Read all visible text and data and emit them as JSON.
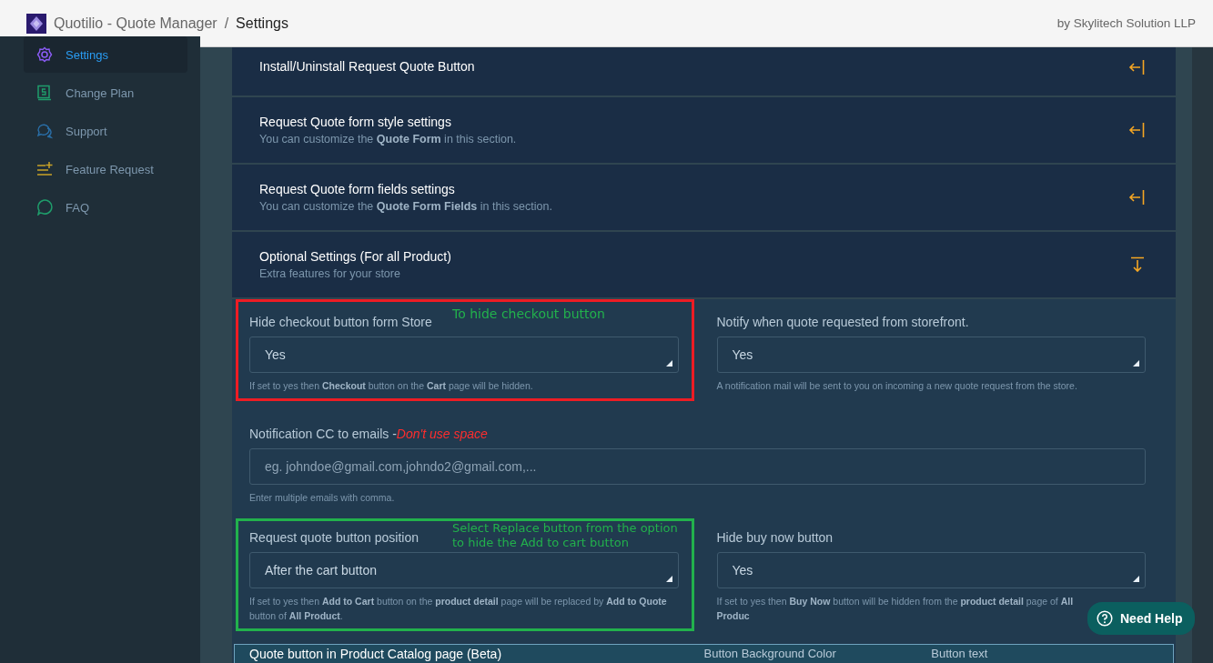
{
  "header": {
    "app_name": "Quotilio - Quote Manager",
    "separator": "/",
    "page": "Settings",
    "vendor": "by Skylitech Solution LLP"
  },
  "sidebar": {
    "items": [
      {
        "label": "Settings",
        "selected": true
      },
      {
        "label": "Change Plan",
        "selected": false
      },
      {
        "label": "Support",
        "selected": false
      },
      {
        "label": "Feature Request",
        "selected": false
      },
      {
        "label": "FAQ",
        "selected": false
      }
    ]
  },
  "sections": [
    {
      "title": "Install/Uninstall Request Quote Button",
      "expanded": false
    },
    {
      "title": "Request Quote form style settings",
      "subtitle": "You can customize the **Quote Form** in this section.",
      "expanded": false
    },
    {
      "title": "Request Quote form fields settings",
      "subtitle": "You can customize the **Quote Form Fields** in this section.",
      "expanded": false
    },
    {
      "title": "Optional Settings (For all Product)",
      "subtitle": "Extra features for your store",
      "expanded": true
    }
  ],
  "form_rows": [
    [
      {
        "kind": "select",
        "label": "Hide checkout button form Store",
        "value": "Yes",
        "hint": "If set to yes then **Checkout** button on the **Cart** page will be hidden.",
        "annotation": {
          "text": "To hide checkout button",
          "color": "#ed1c24"
        }
      },
      {
        "kind": "select",
        "label": "Notify when quote requested from storefront.",
        "value": "Yes",
        "hint": "A notification mail will be sent to you on incoming a new quote request from the store."
      }
    ],
    [
      {
        "kind": "text",
        "label": "Notification CC to emails - ",
        "warning": "Don't use space",
        "placeholder": "eg. johndoe@gmail.com,johndo2@gmail.com,...",
        "hint": "Enter multiple emails with comma."
      }
    ],
    [
      {
        "kind": "select",
        "label": "Request quote button position",
        "value": "After the cart button",
        "hint": "If set to yes then **Add to Cart** button on the **product detail** page will be replaced by **Add to Quote** button of **All Product**.",
        "annotation": {
          "text": "Select Replace button from the option to hide the Add to cart button",
          "color": "#22b14c"
        }
      },
      {
        "kind": "select",
        "label": "Hide buy now button",
        "value": "Yes",
        "hint": "If set to yes then **Buy Now** button will be hidden from the **product detail** page of **All Produc**"
      }
    ]
  ],
  "catalog_panel": {
    "title": "Quote button in Product Catalog page (Beta)",
    "column_2": "Button Background Color",
    "column_3": "Button text"
  },
  "help_button": {
    "label": "Need Help"
  }
}
